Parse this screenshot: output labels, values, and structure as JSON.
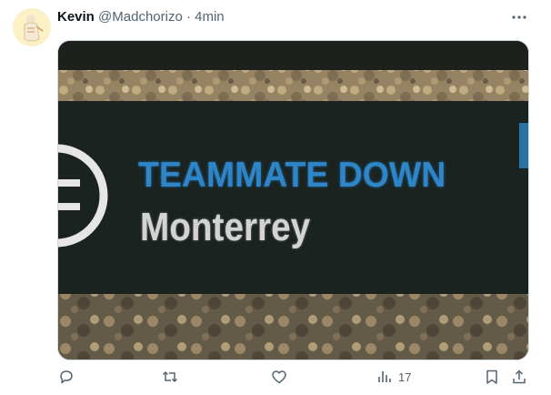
{
  "post": {
    "author_name": "Kevin",
    "handle": "@Madchorizo",
    "separator": "·",
    "time": "4min"
  },
  "media": {
    "headline": "TEAMMATE DOWN",
    "subline": "Monterrey",
    "headline_color": "#2e86c8",
    "subline_color": "#d3d3d3"
  },
  "actions": {
    "reply_icon": "reply-icon",
    "repost_icon": "repost-icon",
    "like_icon": "like-icon",
    "views_icon": "views-icon",
    "views_count": "17",
    "bookmark_icon": "bookmark-icon",
    "share_icon": "share-icon"
  },
  "colors": {
    "text_primary": "#0f1419",
    "text_secondary": "#536471",
    "border": "#cfd9de"
  }
}
